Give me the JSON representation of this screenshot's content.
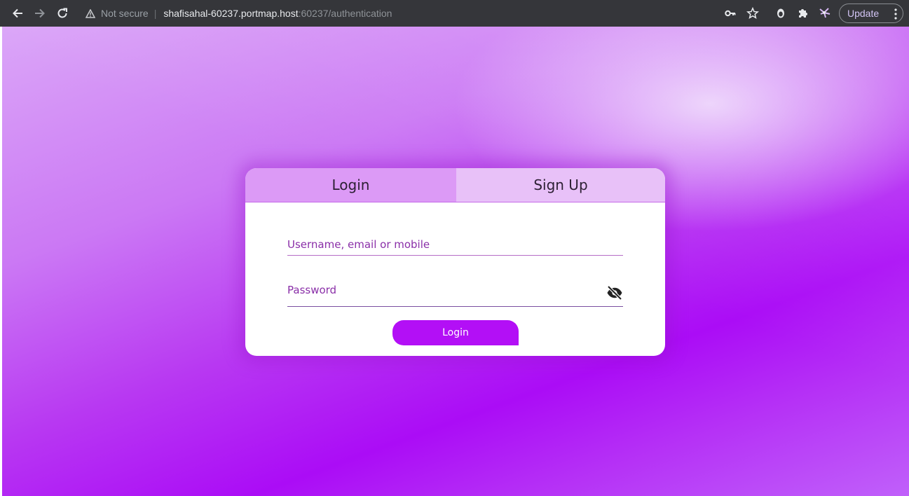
{
  "browser": {
    "security_label": "Not secure",
    "url_host": "shafisahal-60237.portmap.host",
    "url_rest": ":60237/authentication",
    "update_label": "Update"
  },
  "icons": {
    "back": "arrow-left-icon",
    "forward": "arrow-right-icon",
    "reload": "reload-icon",
    "warning": "warning-triangle-icon",
    "key": "key-icon",
    "bookmark": "star-icon",
    "profile": "profile-icon",
    "extensions": "puzzle-icon",
    "extension_app": "extension-app-icon",
    "menu": "vertical-dots-icon",
    "password_visibility": "eye-off-icon"
  },
  "auth": {
    "tabs": [
      {
        "label": "Login",
        "selected": true
      },
      {
        "label": "Sign Up",
        "selected": false
      }
    ],
    "username_placeholder": "Username, email or mobile",
    "password_placeholder": "Password",
    "submit_label": "Login"
  },
  "colors": {
    "accent": "#b30ff6",
    "tab_active": "#dc9af6",
    "tab_inactive": "#e8c1f8",
    "chrome_bg": "#35363a"
  }
}
